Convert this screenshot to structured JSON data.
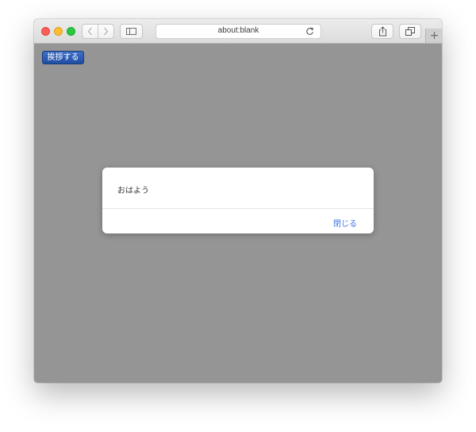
{
  "browser": {
    "address": "about:blank",
    "new_tab_symbol": "+",
    "icons": {
      "back": "chevron-left-icon",
      "forward": "chevron-right-icon",
      "sidebar": "sidebar-icon",
      "reload": "reload-icon",
      "share": "share-icon",
      "tabs": "tabs-overview-icon"
    }
  },
  "page": {
    "greet_button_label": "挨拶する"
  },
  "dialog": {
    "message": "おはよう",
    "close_label": "閉じる",
    "accent_color": "#3f74e6"
  }
}
